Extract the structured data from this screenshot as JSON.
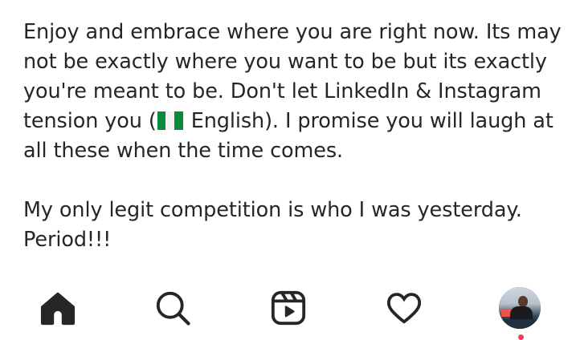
{
  "post": {
    "caption_p1_before_flag": "Enjoy and embrace where you are right now. Its may not be exactly where you want to be but its exactly you're meant to be. Don't let LinkedIn & Instagram tension you (",
    "flag_emoji_name": "nigeria-flag-icon",
    "caption_p1_after_flag": " English). I promise you will laugh at all these when the time comes.",
    "caption_p2": "My only legit competition is who I was yesterday. Period!!!"
  },
  "bottom_nav": {
    "items": [
      {
        "icon": "home-icon",
        "active": true
      },
      {
        "icon": "search-icon",
        "active": false
      },
      {
        "icon": "reels-icon",
        "active": false
      },
      {
        "icon": "heart-icon",
        "active": false
      },
      {
        "icon": "profile-avatar",
        "active": false
      }
    ],
    "notification_dot_color": "#ef3f5a"
  },
  "colors": {
    "text": "#262626",
    "background": "#ffffff",
    "icon": "#262626"
  }
}
